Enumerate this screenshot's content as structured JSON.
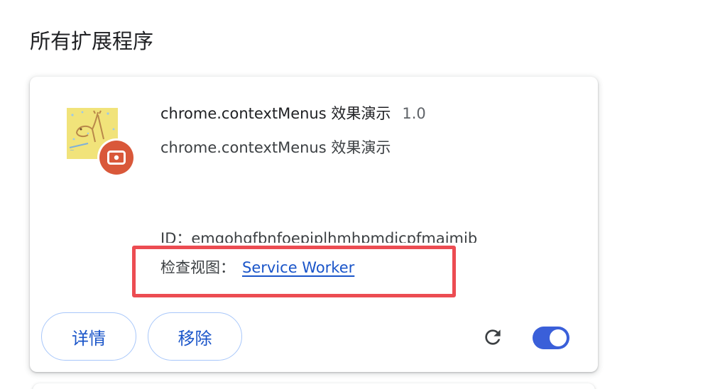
{
  "section": {
    "title": "所有扩展程序"
  },
  "extension": {
    "icon": "giraffe-extension-icon",
    "badge_icon": "unpacked-extension-badge-icon",
    "name": "chrome.contextMenus 效果演示",
    "version": "1.0",
    "description": "chrome.contextMenus 效果演示",
    "id_line": "ID：emgohgfbnfoepiplhmhpmdicpfmajmjb",
    "inspect_label": "检查视图：",
    "inspect_link": "Service Worker",
    "enabled": true
  },
  "actions": {
    "details_label": "详情",
    "remove_label": "移除",
    "reload_icon": "reload-icon",
    "toggle_state": "on"
  },
  "annotation": {
    "highlight_color": "#ec4c52"
  },
  "colors": {
    "accent": "#1a55c9",
    "toggle_on": "#3a5fd9",
    "badge": "#d9583a"
  }
}
